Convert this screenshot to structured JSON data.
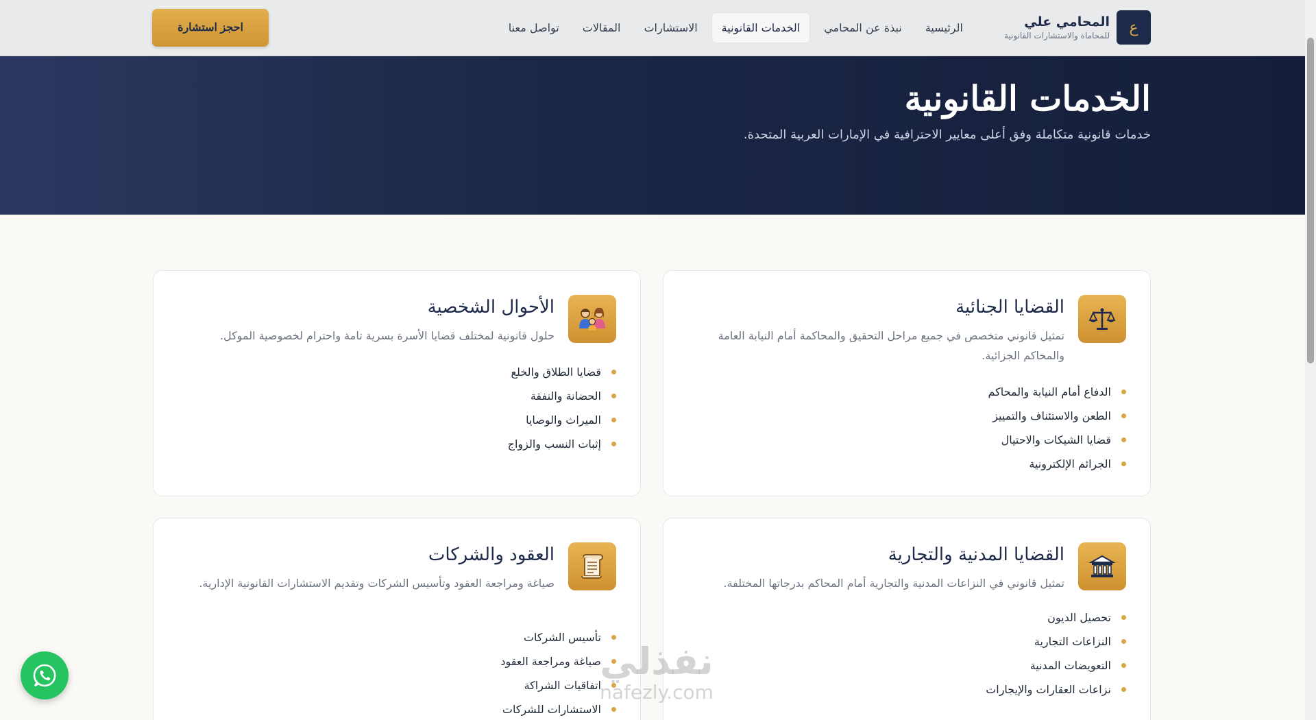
{
  "header": {
    "brand_mark": "ع",
    "brand_name": "المحامي علي",
    "brand_tagline": "للمحاماة والاستشارات القانونية",
    "nav": [
      {
        "label": "الرئيسية",
        "active": false
      },
      {
        "label": "نبذة عن المحامي",
        "active": false
      },
      {
        "label": "الخدمات القانونية",
        "active": true
      },
      {
        "label": "الاستشارات",
        "active": false
      },
      {
        "label": "المقالات",
        "active": false
      },
      {
        "label": "تواصل معنا",
        "active": false
      }
    ],
    "cta_label": "احجز استشارة"
  },
  "hero": {
    "title": "الخدمات القانونية",
    "subtitle": "خدمات قانونية متكاملة وفق أعلى معايير الاحترافية في الإمارات العربية المتحدة."
  },
  "services": [
    {
      "icon": "scales-icon",
      "emoji": "⚖️",
      "title": "القضايا الجنائية",
      "description": "تمثيل قانوني متخصص في جميع مراحل التحقيق والمحاكمة أمام النيابة العامة والمحاكم الجزائية.",
      "items": [
        "الدفاع أمام النيابة والمحاكم",
        "الطعن والاستئناف والتمييز",
        "قضايا الشيكات والاحتيال",
        "الجرائم الإلكترونية"
      ]
    },
    {
      "icon": "family-icon",
      "emoji": "👨‍👩‍👧",
      "title": "الأحوال الشخصية",
      "description": "حلول قانونية لمختلف قضايا الأسرة بسرية تامة واحترام لخصوصية الموكل.",
      "items": [
        "قضايا الطلاق والخلع",
        "الحضانة والنفقة",
        "الميراث والوصايا",
        "إثبات النسب والزواج"
      ]
    },
    {
      "icon": "bank-building-icon",
      "emoji": "🏛️",
      "title": "القضايا المدنية والتجارية",
      "description": "تمثيل قانوني في النزاعات المدنية والتجارية أمام المحاكم بدرجاتها المختلفة.",
      "items": [
        "تحصيل الديون",
        "النزاعات التجارية",
        "التعويضات المدنية",
        "نزاعات العقارات والإيجارات"
      ]
    },
    {
      "icon": "scroll-icon",
      "emoji": "📜",
      "title": "العقود والشركات",
      "description": "صياغة ومراجعة العقود وتأسيس الشركات وتقديم الاستشارات القانونية الإدارية.",
      "items": [
        "تأسيس الشركات",
        "صياغة ومراجعة العقود",
        "اتفاقيات الشراكة",
        "الاستشارات للشركات"
      ]
    }
  ],
  "watermark": {
    "arabic": "نفذلي",
    "latin": "nafezly.com"
  },
  "colors": {
    "navy": "#1e2a4a",
    "gold": "#d9a545",
    "whatsapp": "#25c461"
  }
}
